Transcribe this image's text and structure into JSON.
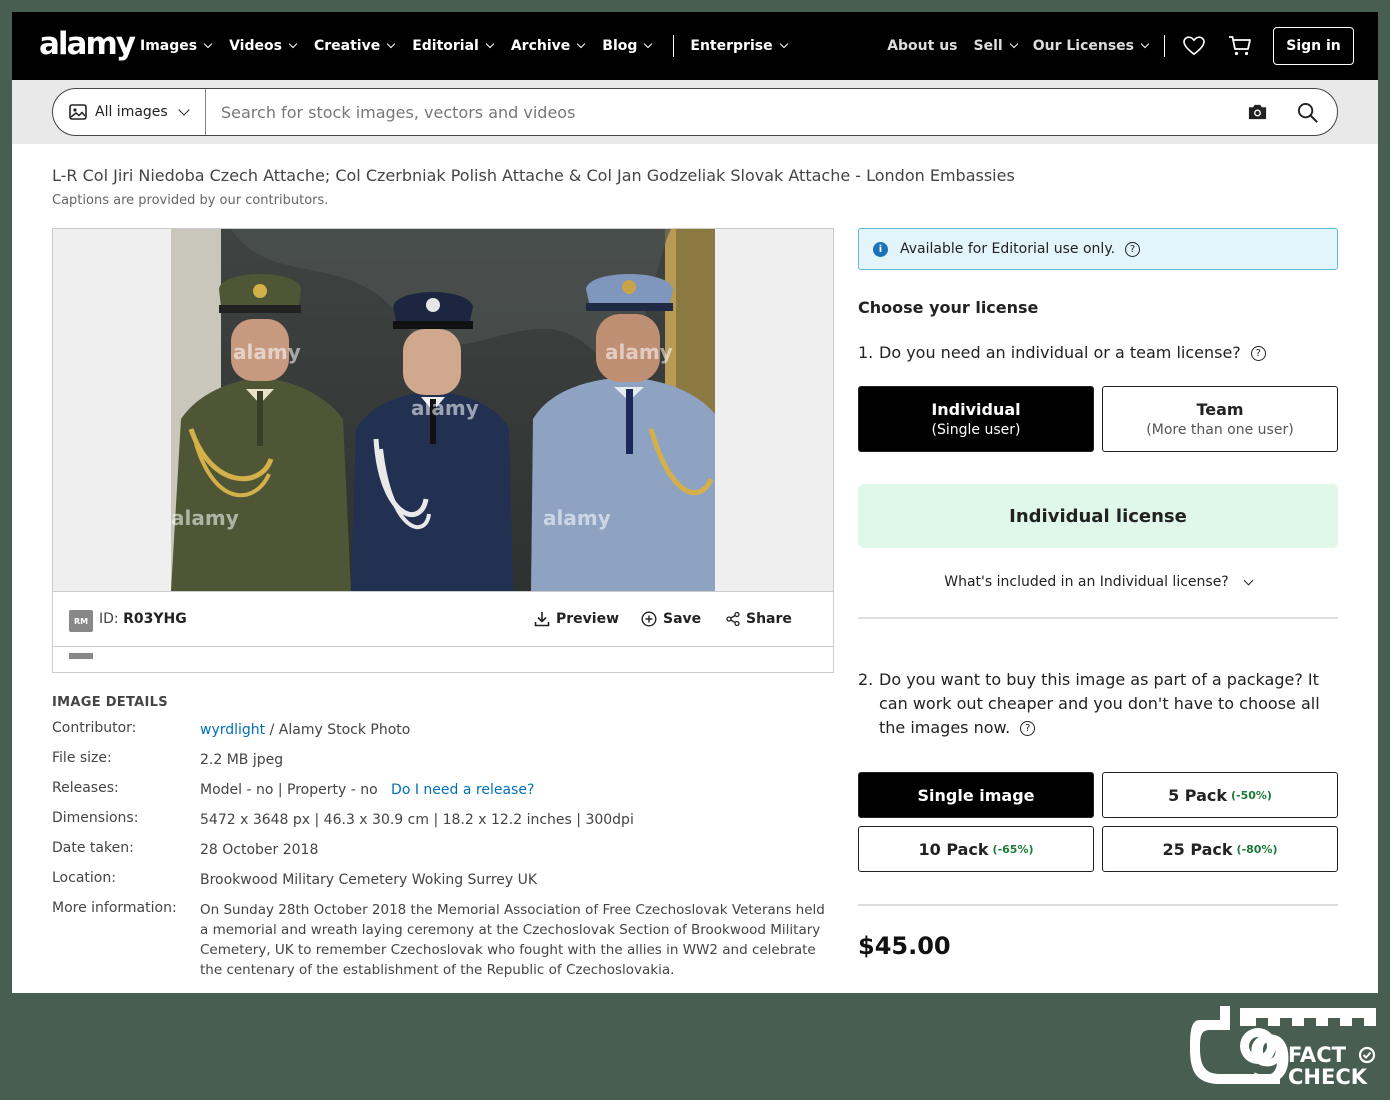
{
  "nav": {
    "logo": "alamy",
    "left_items": [
      "Images",
      "Videos",
      "Creative",
      "Editorial",
      "Archive",
      "Blog"
    ],
    "enterprise": "Enterprise",
    "right_items": {
      "about": "About us",
      "sell": "Sell",
      "licenses": "Our Licenses"
    },
    "signin": "Sign in"
  },
  "search": {
    "scope": "All images",
    "placeholder": "Search for stock images, vectors and videos"
  },
  "caption": {
    "title": "L-R Col Jiri Niedoba Czech Attache; Col Czerbniak Polish Attache & Col Jan Godzeliak Slovak Attache - London Embassies",
    "note": "Captions are provided by our contributors."
  },
  "image_bar": {
    "badge": "RM",
    "id_label": "ID:",
    "id_value": "R03YHG",
    "preview": "Preview",
    "save": "Save",
    "share": "Share",
    "watermark": "alamy"
  },
  "details": {
    "heading": "IMAGE DETAILS",
    "contributor_label": "Contributor:",
    "contributor_name": "wyrdlight",
    "contributor_rest": " / Alamy Stock Photo",
    "filesize_label": "File size:",
    "filesize": "2.2 MB jpeg",
    "releases_label": "Releases:",
    "releases": "Model - no | Property - no",
    "releases_link": "Do I need a release?",
    "dimensions_label": "Dimensions:",
    "dimensions": "5472 x 3648 px | 46.3 x 30.9 cm | 18.2 x 12.2 inches | 300dpi",
    "date_label": "Date taken:",
    "date": "28 October 2018",
    "location_label": "Location:",
    "location": "Brookwood Military Cemetery Woking Surrey UK",
    "info_label": "More information:",
    "info": "On Sunday 28th October 2018 the Memorial Association of Free Czechoslovak Veterans held a memorial and wreath laying ceremony at the Czechoslovak Section of Brookwood Military Cemetery, UK to remember Czechoslovak who fought with the allies in WW2 and celebrate the centenary of the establishment of the Republic of Czechoslovakia."
  },
  "license": {
    "notice": "Available for Editorial use only.",
    "choose": "Choose your license",
    "q1_num": "1.",
    "q1": "Do you need an individual or a team license?",
    "individual": {
      "title": "Individual",
      "sub": "(Single user)"
    },
    "team": {
      "title": "Team",
      "sub": "(More than one user)"
    },
    "selected_license": "Individual license",
    "included": "What's included in an Individual license?",
    "q2_num": "2.",
    "q2": "Do you want to buy this image as part of a package? It can work out cheaper and you don't have to choose all the images now.",
    "packs": [
      {
        "label": "Single image",
        "discount": ""
      },
      {
        "label": "5 Pack",
        "discount": "(-50%)"
      },
      {
        "label": "10 Pack",
        "discount": "(-65%)"
      },
      {
        "label": "25 Pack",
        "discount": "(-80%)"
      }
    ],
    "price": "$45.00"
  },
  "factcheck": {
    "number": "9",
    "line1": "FACT",
    "line2": "CHECK"
  },
  "colors": {
    "accent_link": "#0070b8",
    "license_bg": "#dff8ea",
    "notice_bg": "#e3f4fb",
    "page_bg": "#485e51"
  }
}
